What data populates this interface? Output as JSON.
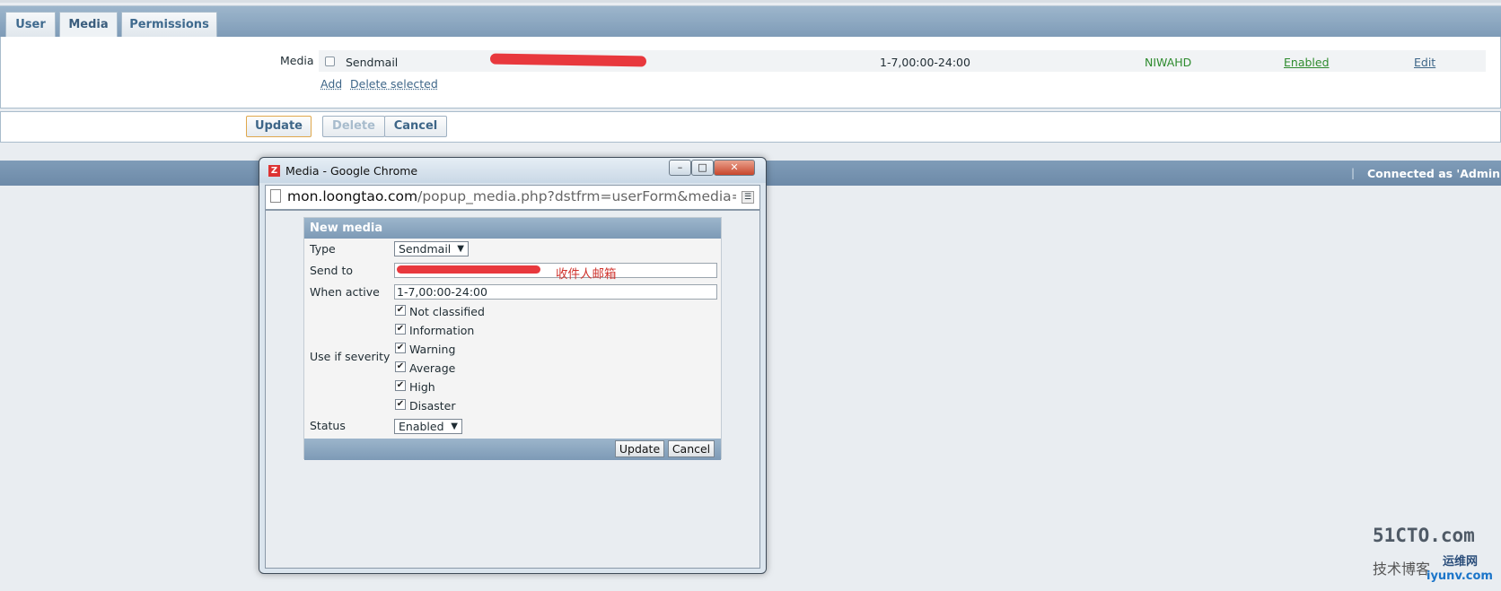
{
  "tabs": [
    {
      "label": "User"
    },
    {
      "label": "Media"
    },
    {
      "label": "Permissions"
    }
  ],
  "media_table": {
    "row_label": "Media",
    "row": {
      "type": "Sendmail",
      "period": "1-7,00:00-24:00",
      "severity": "NIWAHD",
      "status": "Enabled",
      "edit": "Edit"
    },
    "add_label": "Add",
    "delete_selected_label": "Delete selected"
  },
  "form_buttons": {
    "update": "Update",
    "delete": "Delete",
    "cancel": "Cancel"
  },
  "footer": {
    "separator": "|",
    "connected_as": "Connected as 'Admin'"
  },
  "popup": {
    "window_title": "Media - Google Chrome",
    "url_domain": "mon.loongtao.com",
    "url_path": "/popup_media.php?dstfrm=userForm&media=",
    "form_title": "New media",
    "type_label": "Type",
    "type_value": "Sendmail",
    "send_to_label": "Send to",
    "send_to_annotation": "收件人邮箱",
    "when_active_label": "When active",
    "when_active_value": "1-7,00:00-24:00",
    "use_if_severity_label": "Use if severity",
    "severities": [
      {
        "label": "Not classified",
        "checked": true
      },
      {
        "label": "Information",
        "checked": true
      },
      {
        "label": "Warning",
        "checked": true
      },
      {
        "label": "Average",
        "checked": true
      },
      {
        "label": "High",
        "checked": true
      },
      {
        "label": "Disaster",
        "checked": true
      }
    ],
    "status_label": "Status",
    "status_value": "Enabled",
    "update_button": "Update",
    "cancel_button": "Cancel"
  },
  "watermark": {
    "line1": "51CTO.com",
    "line2": "技术博客",
    "line3": "运维网",
    "line4": "iyunv.com"
  },
  "colors": {
    "accent_blue": "#7e9bb7",
    "status_green": "#2e8b2e",
    "update_button_border": "#e0a84c",
    "redaction_red": "#e8383d"
  }
}
